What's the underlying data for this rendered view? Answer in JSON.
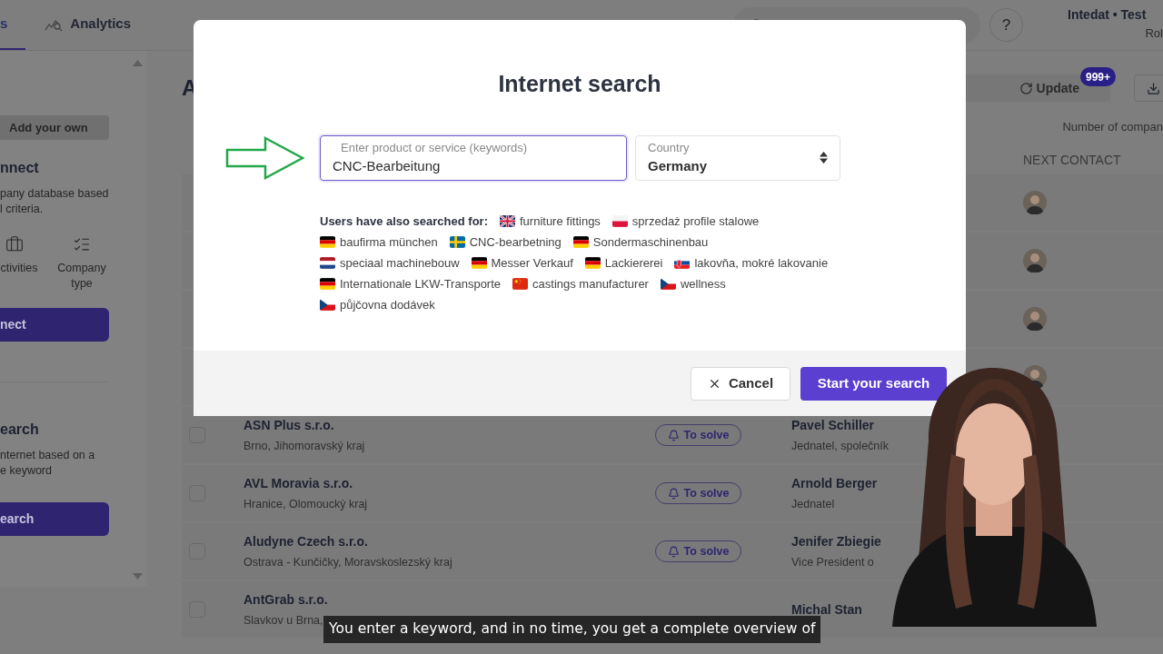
{
  "header": {
    "tabs": [
      {
        "label": "s",
        "selected": true
      },
      {
        "label": "Analytics",
        "selected": false
      }
    ],
    "help": "?",
    "account": {
      "name": "Intedat • Test",
      "role": "Rol"
    }
  },
  "sidebar": {
    "add_button": "Add your own",
    "sections": [
      {
        "heading": "nnect",
        "lines": [
          "pany database based",
          "l criteria."
        ],
        "filters": [
          {
            "label": "ctivities",
            "kind": "briefcase"
          },
          {
            "label": "Company type",
            "kind": "checklist"
          }
        ],
        "button": "nect"
      },
      {
        "heading": "earch",
        "lines": [
          "nternet based on a",
          "e keyword"
        ],
        "button": "earch"
      }
    ]
  },
  "main": {
    "heading": "A",
    "update": {
      "label": "Update",
      "badge": "999+"
    },
    "count_label": "Number of compan",
    "column": "NEXT CONTACT",
    "rows": [
      {
        "avatar": true
      },
      {
        "avatar": true
      },
      {
        "avatar": true
      },
      {
        "avatar": true
      },
      {
        "checked": false,
        "company": "ASN Plus s.r.o.",
        "location": "Brno, Jihomoravský kraj",
        "status": "To solve",
        "contact": "Pavel Schiller",
        "role": "Jednatel, společník",
        "avatar": false
      },
      {
        "checked": false,
        "company": "AVL Moravia s.r.o.",
        "location": "Hranice, Olomoucký kraj",
        "status": "To solve",
        "contact": "Arnold Berger",
        "role": "Jednatel",
        "avatar": false
      },
      {
        "checked": false,
        "company": "Aludyne Czech s.r.o.",
        "location": "Ostrava - Kunčičky, Moravskoslezský kraj",
        "status": "To solve",
        "contact": "Jenifer Zbiegie",
        "role": "Vice President o",
        "avatar": false
      },
      {
        "checked": false,
        "company": "AntGrab s.r.o.",
        "location": "Slavkov u Brna,",
        "contact": "Michal Stan",
        "avatar": false
      }
    ]
  },
  "modal": {
    "title": "Internet search",
    "keyword": {
      "label": "Enter product or service (keywords)",
      "value": "CNC-Bearbeitung"
    },
    "country": {
      "label": "Country",
      "value": "Germany"
    },
    "suggestions_label": "Users have also searched for:",
    "suggestions": [
      {
        "text": "furniture fittings",
        "kind": "gb"
      },
      {
        "text": "sprzedaż profile stalowe",
        "kind": "pl"
      },
      {
        "text": "baufirma münchen",
        "kind": "de"
      },
      {
        "text": "CNC-bearbetning",
        "kind": "se"
      },
      {
        "text": "Sondermaschinenbau",
        "kind": "de"
      },
      {
        "text": "speciaal machinebouw",
        "kind": "nl"
      },
      {
        "text": "Messer Verkauf",
        "kind": "de"
      },
      {
        "text": "Lackiererei",
        "kind": "de"
      },
      {
        "text": "lakovňa, mokré lakovanie",
        "kind": "sk"
      },
      {
        "text": "Internationale LKW-Transporte",
        "kind": "de"
      },
      {
        "text": "castings manufacturer",
        "kind": "cn"
      },
      {
        "text": "wellness",
        "kind": "cz"
      },
      {
        "text": "půjčovna dodávek",
        "kind": "cz"
      }
    ],
    "cancel": "Cancel",
    "start": "Start your search"
  },
  "subtitle": "You enter a keyword, and in no time, you get a complete overview of"
}
